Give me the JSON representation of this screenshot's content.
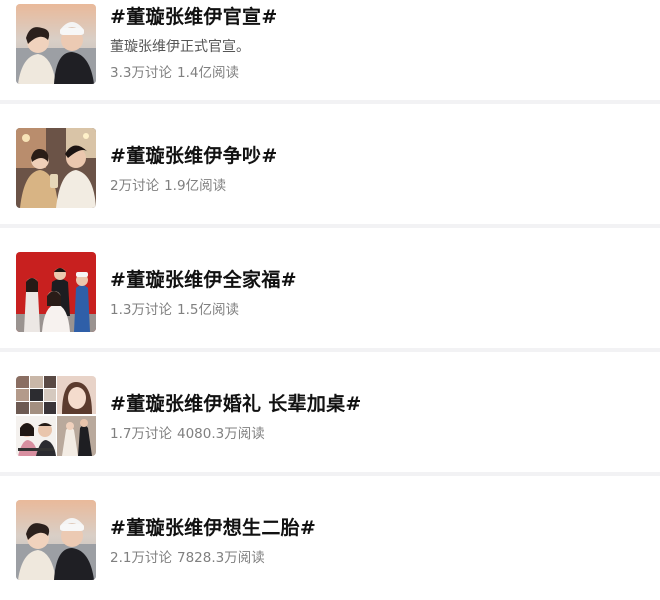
{
  "topics": [
    {
      "title": "#董璇张维伊官宣#",
      "description": "董璇张维伊正式官宣。",
      "discussions": "3.3万讨论",
      "reads": "1.4亿阅读",
      "thumbnail": "couple-beach-selfie"
    },
    {
      "title": "#董璇张维伊争吵#",
      "description": "",
      "discussions": "2万讨论",
      "reads": "1.9亿阅读",
      "thumbnail": "couple-party-photo"
    },
    {
      "title": "#董璇张维伊全家福#",
      "description": "",
      "discussions": "1.3万讨论",
      "reads": "1.5亿阅读",
      "thumbnail": "family-photo-red-background"
    },
    {
      "title": "#董璇张维伊婚礼 长辈加桌#",
      "description": "",
      "discussions": "1.7万讨论",
      "reads": "4080.3万阅读",
      "thumbnail": "wedding-photo-collage"
    },
    {
      "title": "#董璇张维伊想生二胎#",
      "description": "",
      "discussions": "2.1万讨论",
      "reads": "7828.3万阅读",
      "thumbnail": "couple-beach-selfie"
    }
  ],
  "colors": {
    "title": "#111111",
    "description": "#555555",
    "stats": "#808080",
    "divider": "#f2f2f4"
  }
}
